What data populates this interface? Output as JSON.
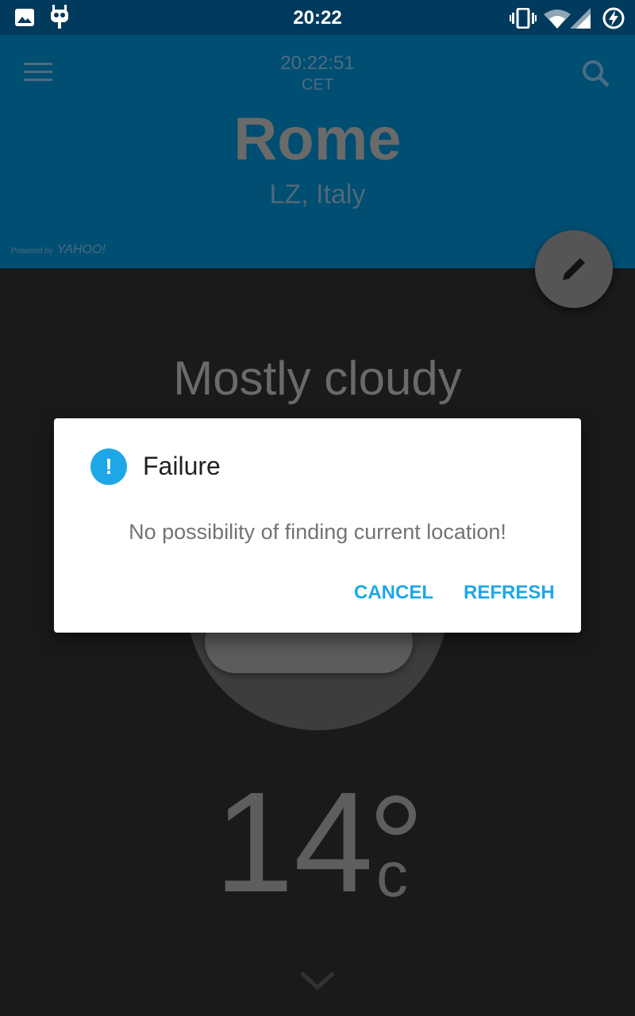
{
  "status_bar": {
    "time": "20:22",
    "icons": [
      "image-icon",
      "android-icon",
      "vibrate-icon",
      "wifi-icon",
      "signal-icon",
      "battery-charging-icon"
    ]
  },
  "header": {
    "clock": "20:22:51",
    "timezone": "CET",
    "city": "Rome",
    "region": "LZ, Italy",
    "powered_by": "Powered by",
    "provider": "YAHOO!",
    "menu_icon": "menu-icon",
    "search_icon": "search-icon",
    "color": "#004e72"
  },
  "fab": {
    "icon": "edit-pencil-icon"
  },
  "weather": {
    "condition": "Mostly cloudy",
    "temperature": "14",
    "unit": "c"
  },
  "dialog": {
    "title": "Failure",
    "message": "No possibility of finding current location!",
    "cancel_label": "CANCEL",
    "refresh_label": "REFRESH",
    "accent_color": "#1ea7e6"
  }
}
